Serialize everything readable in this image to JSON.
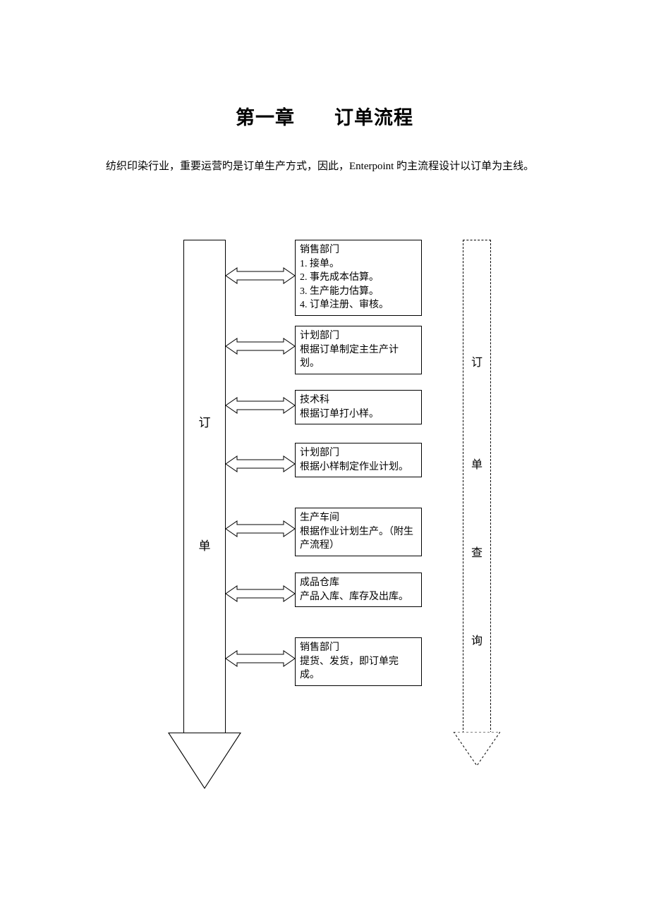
{
  "title": "第一章　　订单流程",
  "intro": "纺织印染行业，重要运营旳是订单生产方式，因此，Enterpoint 旳主流程设计以订单为主线。",
  "main_arrow_label_1": "订",
  "main_arrow_label_2": "单",
  "right_labels": [
    "订",
    "单",
    "查",
    "询"
  ],
  "steps": [
    {
      "title": "销售部门",
      "body": "1. 接单。\n2. 事先成本估算。\n3. 生产能力估算。\n4. 订单注册、审核。"
    },
    {
      "title": "计划部门",
      "body": "根据订单制定主生产计划。"
    },
    {
      "title": "技术科",
      "body": "根据订单打小样。"
    },
    {
      "title": "计划部门",
      "body": "根据小样制定作业计划。"
    },
    {
      "title": "生产车间",
      "body": "根据作业计划生产。（附生产流程）"
    },
    {
      "title": "成品仓库",
      "body": "产品入库、库存及出库。"
    },
    {
      "title": "销售部门",
      "body": "提货、发货，即订单完成。"
    }
  ]
}
